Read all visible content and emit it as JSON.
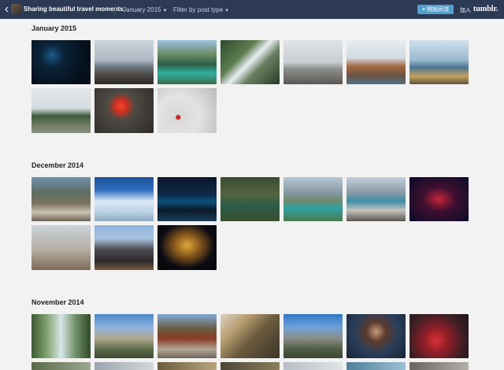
{
  "header": {
    "blog_title": "Sharing beautiful travel moments",
    "month_filter": "January 2015",
    "post_type_filter": "Filter by post type",
    "follow_label": "開始同流",
    "join_label": "加入",
    "logo": "tumblr."
  },
  "sections": [
    {
      "heading": "January 2015",
      "photo_count": 10
    },
    {
      "heading": "December 2014",
      "photo_count": 10
    },
    {
      "heading": "November 2014",
      "photo_count": 14
    }
  ],
  "colors": {
    "topbar": "#2c3a55",
    "accent": "#529ecc",
    "background": "#f2f2f2"
  }
}
